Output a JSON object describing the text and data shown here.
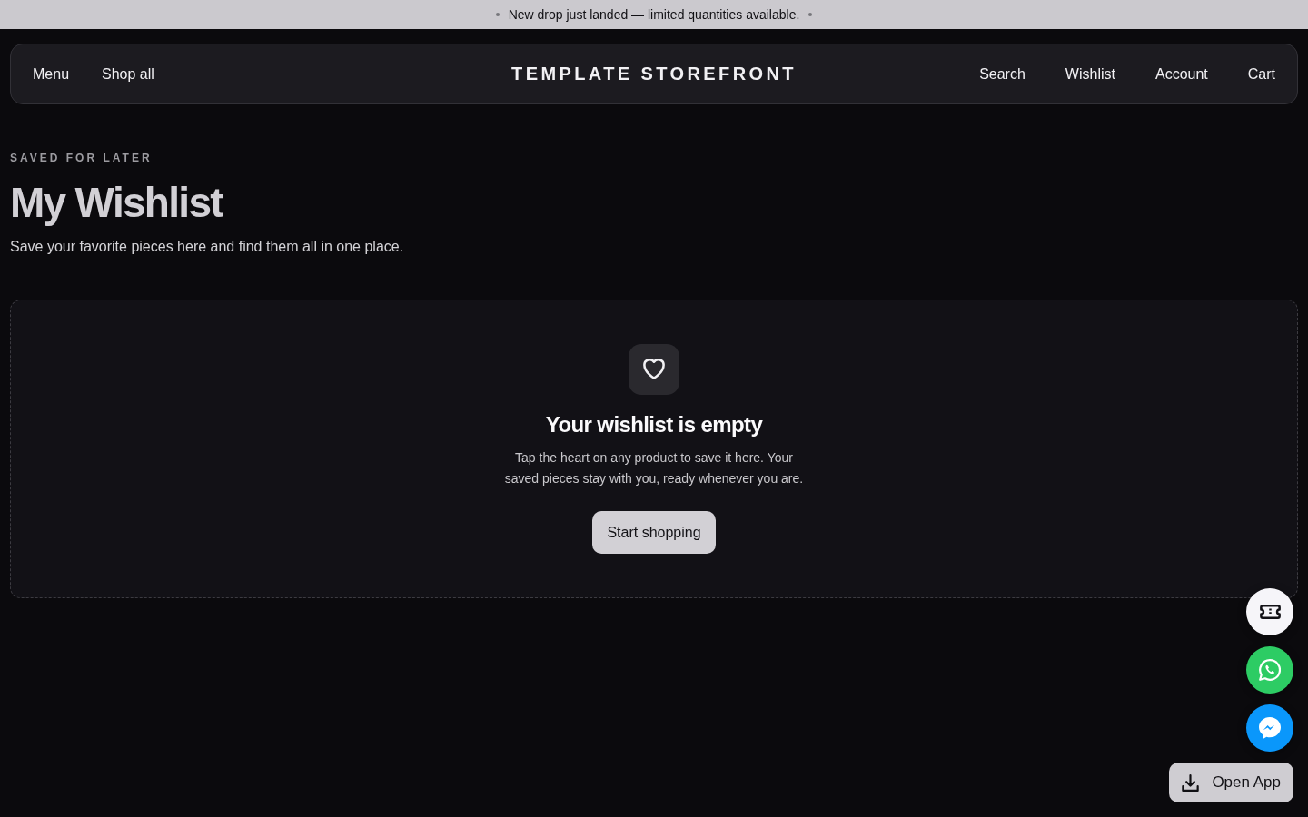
{
  "announcement": {
    "text": "New drop just landed — limited quantities available."
  },
  "header": {
    "left_links": [
      "Menu",
      "Shop all"
    ],
    "brand": "TEMPLATE STOREFRONT",
    "right_links": [
      "Search",
      "Wishlist",
      "Account",
      "Cart"
    ]
  },
  "page": {
    "eyebrow": "SAVED FOR LATER",
    "title": "My Wishlist",
    "subtitle": "Save your favorite pieces here and find them all in one place."
  },
  "empty_state": {
    "title": "Your wishlist is empty",
    "message": "Tap the heart on any product to save it here. Your saved pieces stay with you, ready whenever you are.",
    "button": "Start shopping"
  },
  "floating_actions": [
    {
      "kind": "ticket",
      "color": "#f6f5f9"
    },
    {
      "kind": "whatsapp",
      "color": "#2dcc64"
    },
    {
      "kind": "messenger",
      "color": "#0a97fb"
    }
  ],
  "open_app_button": {
    "label": "Open App"
  }
}
